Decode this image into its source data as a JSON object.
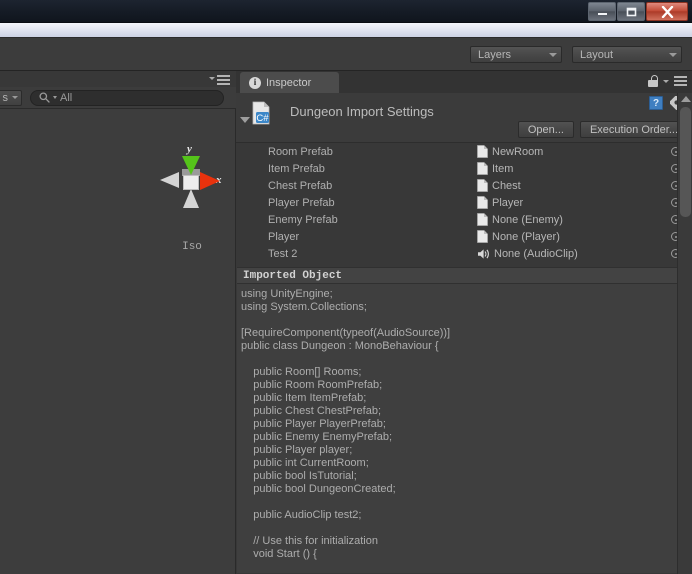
{
  "window": {
    "buttons": [
      {
        "name": "minimize-button",
        "glyph": "—"
      },
      {
        "name": "maximize-button",
        "glyph": "❐"
      },
      {
        "name": "close-button",
        "glyph": "✕"
      }
    ]
  },
  "toolbar": {
    "layers_label": "Layers",
    "layout_label": "Layout"
  },
  "left_panel": {
    "filter_dropdown_label": "s",
    "search_value": "All",
    "search_placeholder": "All",
    "gizmo": {
      "axis_y_label": "y",
      "axis_x_label": "x",
      "view_label": "Iso"
    }
  },
  "inspector": {
    "tab_label": "Inspector",
    "title": "Dungeon Import Settings",
    "open_button": "Open...",
    "execution_order_button": "Execution Order...",
    "properties": [
      {
        "label": "Room Prefab",
        "value": "NewRoom",
        "icon": "prefab-icon"
      },
      {
        "label": "Item Prefab",
        "value": "Item",
        "icon": "prefab-icon"
      },
      {
        "label": "Chest Prefab",
        "value": "Chest",
        "icon": "prefab-icon"
      },
      {
        "label": "Player Prefab",
        "value": "Player",
        "icon": "prefab-icon"
      },
      {
        "label": "Enemy Prefab",
        "value": "None (Enemy)",
        "icon": "prefab-icon"
      },
      {
        "label": "Player",
        "value": "None (Player)",
        "icon": "prefab-icon"
      },
      {
        "label": "Test 2",
        "value": "None (AudioClip)",
        "icon": "audioclip-icon"
      }
    ],
    "imported_object_header": "Imported Object",
    "code": "using UnityEngine;\nusing System.Collections;\n\n[RequireComponent(typeof(AudioSource))]\npublic class Dungeon : MonoBehaviour {\n\n    public Room[] Rooms;\n    public Room RoomPrefab;\n    public Item ItemPrefab;\n    public Chest ChestPrefab;\n    public Player PlayerPrefab;\n    public Enemy EnemyPrefab;\n    public Player player;\n    public int CurrentRoom;\n    public bool IsTutorial;\n    public bool DungeonCreated;\n\n    public AudioClip test2;\n\n    // Use this for initialization\n    void Start () {"
  },
  "colors": {
    "panel_bg": "#383838",
    "code_bg": "#3f3f3f",
    "axis_x": "#e8320d",
    "axis_y": "#55c41a",
    "close_button": "#c14a35"
  }
}
